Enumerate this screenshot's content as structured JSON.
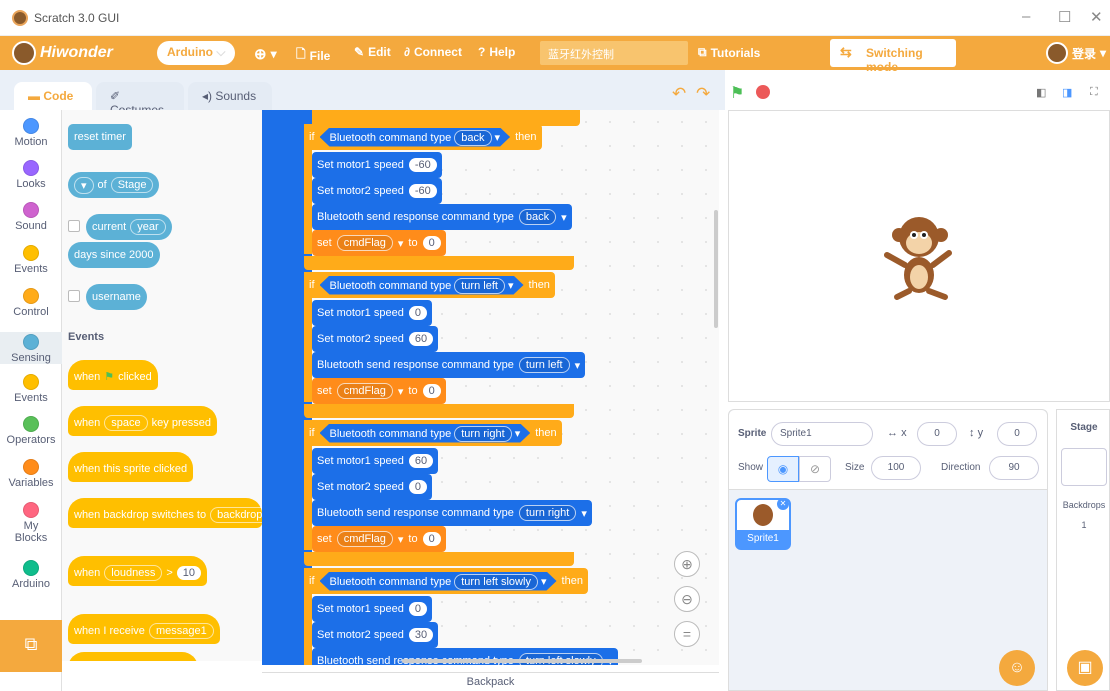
{
  "window": {
    "title": "Scratch 3.0 GUI"
  },
  "menubar": {
    "logo": "Hiwonder",
    "board": "Arduino",
    "file": "File",
    "edit": "Edit",
    "connect": "Connect",
    "help": "Help",
    "project": "蓝牙红外控制",
    "tutorials": "Tutorials",
    "switch_mode": "Switching mode",
    "login": "登录"
  },
  "tabs": {
    "code": "Code",
    "costumes": "Costumes",
    "sounds": "Sounds"
  },
  "categories": [
    {
      "label": "Motion",
      "color": "#4c97ff"
    },
    {
      "label": "Looks",
      "color": "#9966ff"
    },
    {
      "label": "Sound",
      "color": "#cf63cf"
    },
    {
      "label": "Events",
      "color": "#ffbf00"
    },
    {
      "label": "Control",
      "color": "#ffab19"
    },
    {
      "label": "Sensing",
      "color": "#5cb1d6"
    },
    {
      "label": "Events",
      "color": "#ffbf00"
    },
    {
      "label": "Operators",
      "color": "#59c059"
    },
    {
      "label": "Variables",
      "color": "#ff8c1a"
    },
    {
      "label": "My Blocks",
      "color": "#ff6680"
    },
    {
      "label": "Arduino",
      "color": "#0fbd8c"
    }
  ],
  "palette": {
    "reset_timer": "reset timer",
    "of": "of",
    "stage": "Stage",
    "current": "current",
    "year": "year",
    "days_since": "days since 2000",
    "username": "username",
    "events_heading": "Events",
    "when_flag": "when",
    "clicked": "clicked",
    "when_key": "when",
    "space": "space",
    "key_pressed": "key pressed",
    "sprite_clicked": "when this sprite clicked",
    "backdrop_switch": "when backdrop switches to",
    "backdrop": "backdrop",
    "when_loudness": "when",
    "loudness": "loudness",
    "gt": ">",
    "ten": "10",
    "receive": "when I receive",
    "message1": "message1"
  },
  "script": {
    "if": "if",
    "then": "then",
    "bt_type": "Bluetooth command type",
    "set_m1": "Set motor1 speed",
    "set_m2": "Set motor2 speed",
    "bt_send": "Bluetooth send response command type",
    "set": "set",
    "cmdflag": "cmdFlag",
    "to": "to",
    "groups": [
      {
        "cmd": "back",
        "m1": "-60",
        "m2": "-60",
        "flag": "0"
      },
      {
        "cmd": "turn left",
        "m1": "0",
        "m2": "60",
        "flag": "0"
      },
      {
        "cmd": "turn right",
        "m1": "60",
        "m2": "0",
        "flag": "0"
      },
      {
        "cmd": "turn left slowly",
        "m1": "0",
        "m2": "30",
        "flag": ""
      }
    ]
  },
  "sprite": {
    "label": "Sprite",
    "name": "Sprite1",
    "x_label": "x",
    "x": "0",
    "y_label": "y",
    "y": "0",
    "show": "Show",
    "size_label": "Size",
    "size": "100",
    "direction_label": "Direction",
    "direction": "90",
    "thumb": "Sprite1"
  },
  "stage": {
    "label": "Stage",
    "backdrops": "Backdrops",
    "backdrop_count": "1"
  },
  "backpack": "Backpack"
}
